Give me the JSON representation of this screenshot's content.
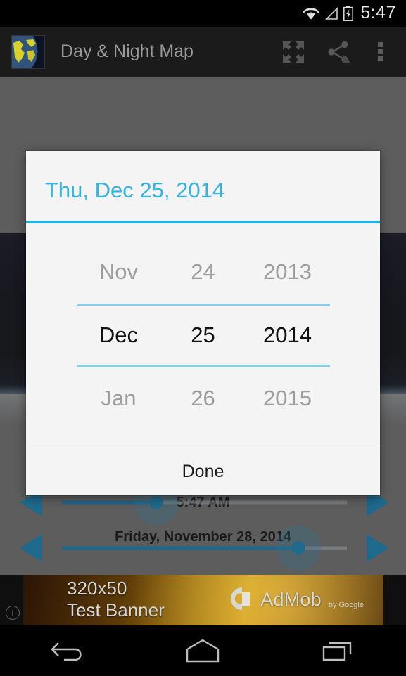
{
  "status_bar": {
    "time": "5:47",
    "icons": [
      "wifi-icon",
      "signal-icon",
      "battery-charging-icon"
    ]
  },
  "action_bar": {
    "app_icon": "world-map-icon",
    "title": "Day & Night Map",
    "buttons": [
      {
        "name": "fullscreen-button",
        "icon": "fullscreen-expand-icon"
      },
      {
        "name": "share-button",
        "icon": "share-icon"
      },
      {
        "name": "overflow-menu-button",
        "icon": "more-vertical-icon"
      }
    ]
  },
  "main": {
    "time_slider": {
      "label": "5:47 AM",
      "value_percent": 33,
      "left_arrow": "arrow-left-icon",
      "right_arrow": "arrow-right-icon"
    },
    "date_slider": {
      "label": "Friday, November 28, 2014",
      "value_percent": 83,
      "left_arrow": "arrow-left-icon",
      "right_arrow": "arrow-right-icon"
    }
  },
  "dialog": {
    "header_date": "Thu, Dec 25, 2014",
    "accent_color": "#29b0e0",
    "divider_color": "#85cdea",
    "header_text_color": "#30b4e4",
    "month_column": {
      "previous": "Nov",
      "selected": "Dec",
      "next": "Jan"
    },
    "day_column": {
      "previous": "24",
      "selected": "25",
      "next": "26"
    },
    "year_column": {
      "previous": "2013",
      "selected": "2014",
      "next": "2015"
    },
    "done_label": "Done"
  },
  "ad_banner": {
    "size_line1": "320x50",
    "size_line2": "Test Banner",
    "brand": "AdMob",
    "brand_sub": "by Google",
    "info_icon": "info-icon"
  },
  "nav_bar": {
    "buttons": [
      {
        "name": "nav-back-button",
        "icon": "back-arrow-icon"
      },
      {
        "name": "nav-home-button",
        "icon": "home-icon"
      },
      {
        "name": "nav-recents-button",
        "icon": "recents-icon"
      }
    ]
  }
}
